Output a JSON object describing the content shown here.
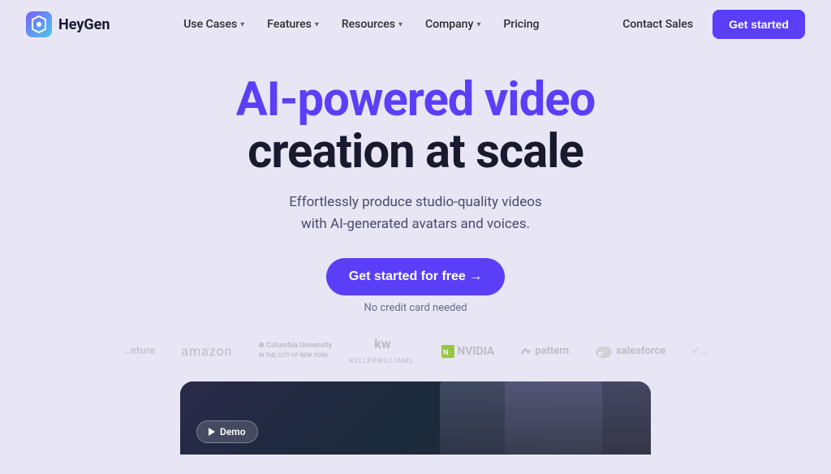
{
  "nav": {
    "logo_text": "HeyGen",
    "items": [
      {
        "label": "Use Cases",
        "has_dropdown": true
      },
      {
        "label": "Features",
        "has_dropdown": true
      },
      {
        "label": "Resources",
        "has_dropdown": true
      },
      {
        "label": "Company",
        "has_dropdown": true
      },
      {
        "label": "Pricing",
        "has_dropdown": false
      }
    ],
    "contact_sales": "Contact Sales",
    "get_started": "Get started"
  },
  "hero": {
    "title_line1": "AI-powered video",
    "title_line2": "creation at scale",
    "subtitle_line1": "Effortlessly produce studio-quality videos",
    "subtitle_line2": "with AI-generated avatars and voices.",
    "cta_button": "Get started for free →",
    "cta_note": "No credit card needed"
  },
  "logos": [
    {
      "name": "ventura",
      "text": "venture",
      "partial": true
    },
    {
      "name": "amazon",
      "text": "amazon"
    },
    {
      "name": "columbia",
      "text": "Columbia University",
      "multiline": true
    },
    {
      "name": "kellerwilliams",
      "text": "kw\nKELLERWILLIAMS."
    },
    {
      "name": "nvidia",
      "text": "NVIDIA"
    },
    {
      "name": "pattern",
      "text": "✓ pattern"
    },
    {
      "name": "salesforce",
      "text": "salesforce"
    }
  ],
  "demo": {
    "play_label": "Demo"
  }
}
